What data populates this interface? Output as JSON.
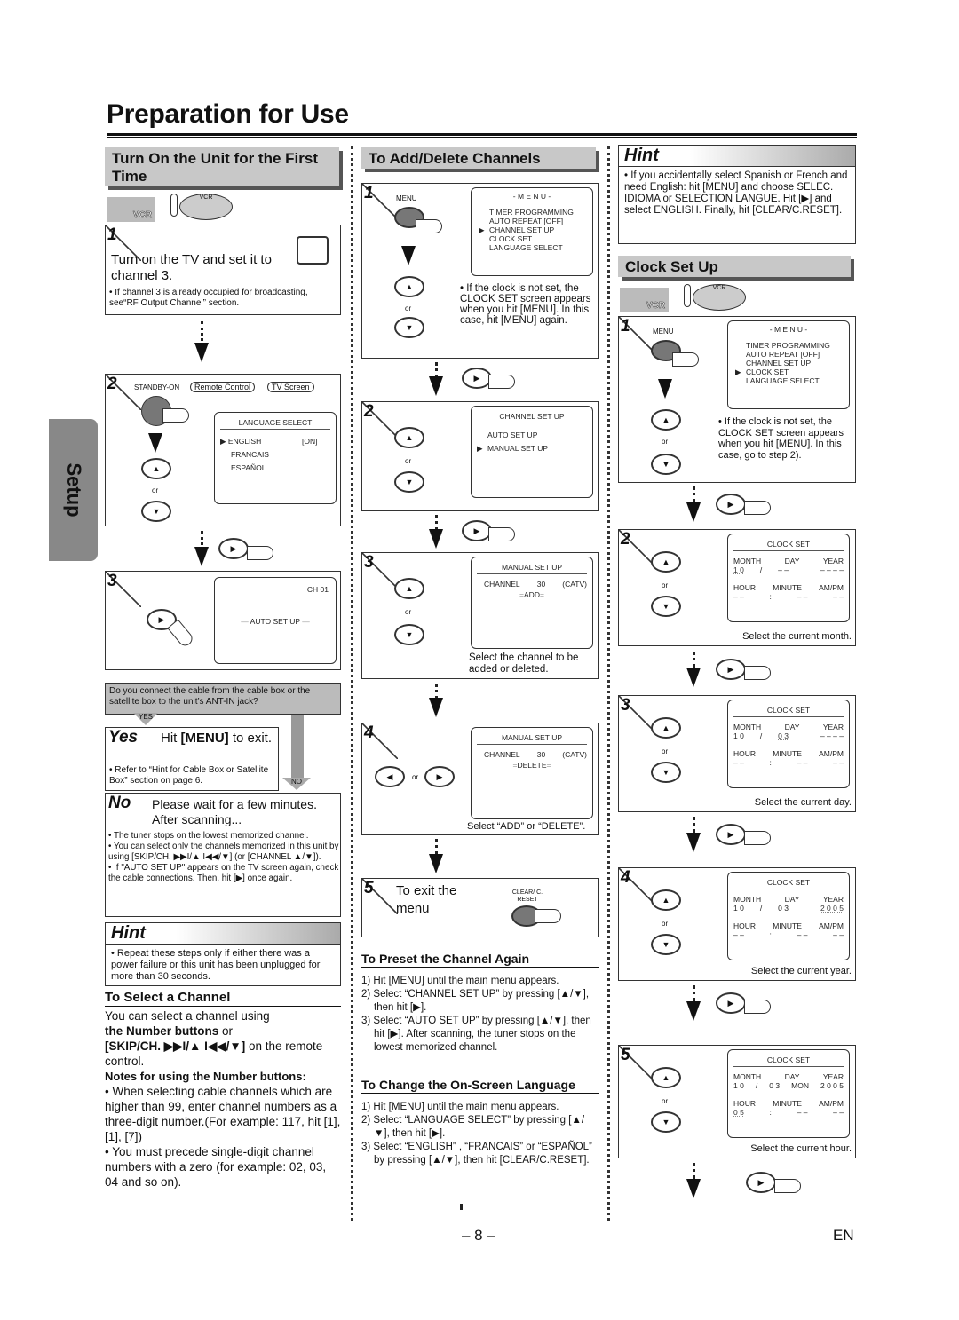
{
  "page": {
    "title": "Preparation for Use",
    "side_tab": "Setup",
    "page_number": "– 8 –",
    "language_code": "EN"
  },
  "col1": {
    "heading": "Turn On the Unit for the First Time",
    "vcr_label": "VCR",
    "remote_label": "VCR",
    "step1": {
      "num": "1",
      "text": "Turn on the TV and set it to channel 3.",
      "note": "• If channel 3 is already occupied for broadcasting, see“RF Output Channel” section."
    },
    "step2": {
      "num": "2",
      "standby_label": "STANDBY-ON",
      "bubble_remote": "Remote Control",
      "bubble_tv": "TV Screen",
      "or": "or",
      "screen": {
        "title": "LANGUAGE SELECT",
        "items": [
          "ENGLISH",
          "FRANCAIS",
          "ESPAÑOL"
        ],
        "selected_state": "[ON]"
      }
    },
    "step3": {
      "num": "3",
      "screen_channel": "CH 01",
      "screen_text": "AUTO SET UP"
    },
    "question": "Do you connect the cable from the cable box or the satellite box to the unit’s ANT-IN jack?",
    "yes_tag": "YES",
    "no_tag": "NO",
    "yes_box": {
      "label": "Yes",
      "text_pre": "Hit ",
      "text_bold": "[MENU]",
      "text_post": " to exit.",
      "note": "• Refer to “Hint for Cable Box or Satellite Box” section on page 6."
    },
    "no_box": {
      "label": "No",
      "text": "Please wait for a few minutes. After scanning...",
      "bullets": [
        "• The tuner stops on the lowest memorized channel.",
        "• You can select only the channels memorized in this unit by using [SKIP/CH. ▶▶I/▲ I◀◀/▼] (or [CHANNEL ▲/▼]).",
        "• If \"AUTO SET UP\" appears on the TV screen again, check the cable connections. Then, hit [▶] once again."
      ]
    },
    "hint": {
      "title": "Hint",
      "text": "• Repeat these steps only if either there was a power failure or this unit has been unplugged for more than 30 seconds."
    },
    "select_channel": {
      "heading": "To Select a Channel",
      "intro1": "You can select a channel using",
      "intro_bold": "the Number buttons",
      "intro2": " or",
      "intro_bold2": "[SKIP/CH. ▶▶I/▲ I◀◀/▼]",
      "intro3": " on the remote control.",
      "notes_heading": "Notes for using the Number buttons:",
      "notes": [
        "• When selecting cable channels which are higher than 99, enter channel numbers as a three-digit number.(For example: 117, hit [1], [1], [7])",
        "• You must precede single-digit channel numbers with a zero (for example: 02, 03, 04 and so on)."
      ]
    }
  },
  "col2": {
    "heading": "To Add/Delete Channels",
    "step1": {
      "num": "1",
      "menu_label": "MENU",
      "or": "or",
      "screen": {
        "title": "- M E N U -",
        "items": [
          "TIMER PROGRAMMING",
          "AUTO REPEAT  [OFF]",
          "CHANNEL SET UP",
          "CLOCK SET",
          "LANGUAGE SELECT"
        ],
        "selected_index": 2
      },
      "note": "• If the clock is not set, the CLOCK SET screen appears when you hit [MENU]. In this case, hit [MENU] again."
    },
    "step2": {
      "num": "2",
      "or": "or",
      "screen": {
        "title": "CHANNEL SET UP",
        "items": [
          "AUTO SET UP",
          "MANUAL SET UP"
        ],
        "selected_index": 1
      }
    },
    "step3": {
      "num": "3",
      "or": "or",
      "screen": {
        "title": "MANUAL SET UP",
        "channel_label": "CHANNEL",
        "channel_value": "30",
        "channel_type": "(CATV)",
        "status": "ADD"
      },
      "caption": "Select the channel to be added or deleted."
    },
    "step4": {
      "num": "4",
      "or": "or",
      "screen": {
        "title": "MANUAL SET UP",
        "channel_label": "CHANNEL",
        "channel_value": "30",
        "channel_type": "(CATV)",
        "status": "DELETE"
      },
      "caption": "Select “ADD” or “DELETE”."
    },
    "step5": {
      "num": "5",
      "text": "To exit the menu",
      "button_label": "CLEAR/ C. RESET"
    },
    "preset": {
      "heading": "To Preset the Channel Again",
      "steps": [
        "1) Hit [MENU] until the main menu appears.",
        "2) Select “CHANNEL SET UP” by pressing [▲/▼], then hit [▶].",
        "3) Select “AUTO SET UP” by pressing [▲/▼], then hit [▶]. After scanning, the tuner stops on the lowest memorized channel."
      ]
    },
    "language": {
      "heading": "To Change the On-Screen Language",
      "steps": [
        "1) Hit [MENU] until the main menu appears.",
        "2) Select “LANGUAGE SELECT” by pressing [▲/▼], then hit [▶].",
        "3) Select “ENGLISH” , “FRANCAIS” or “ESPAÑOL” by pressing [▲/▼], then hit [CLEAR/C.RESET]."
      ]
    }
  },
  "col3": {
    "hint": {
      "title": "Hint",
      "text": "• If you accidentally select Spanish or French and need English: hit [MENU] and choose SELEC. IDIOMA or SELECTION LANGUE. Hit [▶] and select ENGLISH. Finally, hit [CLEAR/C.RESET]."
    },
    "heading": "Clock Set Up",
    "vcr_label": "VCR",
    "step1": {
      "num": "1",
      "menu_label": "MENU",
      "or": "or",
      "screen": {
        "title": "- M E N U -",
        "items": [
          "TIMER PROGRAMMING",
          "AUTO REPEAT  [OFF]",
          "CHANNEL SET UP",
          "CLOCK SET",
          "LANGUAGE SELECT"
        ],
        "selected_index": 3
      },
      "note": "• If the clock is not set, the CLOCK SET screen appears when you hit [MENU]. In this case, go to step 2)."
    },
    "clock_steps": [
      {
        "num": "2",
        "title": "CLOCK SET",
        "month": "1 0",
        "day": "– –",
        "weekday": "",
        "year": "– – – –",
        "hour": "– –",
        "minute": "– –",
        "ampm": "– –",
        "active": "month",
        "caption": "Select the current month."
      },
      {
        "num": "3",
        "title": "CLOCK SET",
        "month": "1 0",
        "day": "0 3",
        "weekday": "",
        "year": "– – – –",
        "hour": "– –",
        "minute": "– –",
        "ampm": "– –",
        "active": "day",
        "caption": "Select the current day."
      },
      {
        "num": "4",
        "title": "CLOCK SET",
        "month": "1 0",
        "day": "0 3",
        "weekday": "",
        "year": "2 0 0 5",
        "hour": "– –",
        "minute": "– –",
        "ampm": "– –",
        "active": "year",
        "caption": "Select the current year."
      },
      {
        "num": "5",
        "title": "CLOCK SET",
        "month": "1 0",
        "day": "0 3",
        "weekday": "MON",
        "year": "2 0 0 5",
        "hour": "0 5",
        "minute": "– –",
        "ampm": "– –",
        "active": "hour",
        "caption": "Select the current hour."
      }
    ],
    "clock_labels": {
      "month": "MONTH",
      "day": "DAY",
      "year": "YEAR",
      "hour": "HOUR",
      "minute": "MINUTE",
      "ampm": "AM/PM"
    },
    "or": "or"
  }
}
